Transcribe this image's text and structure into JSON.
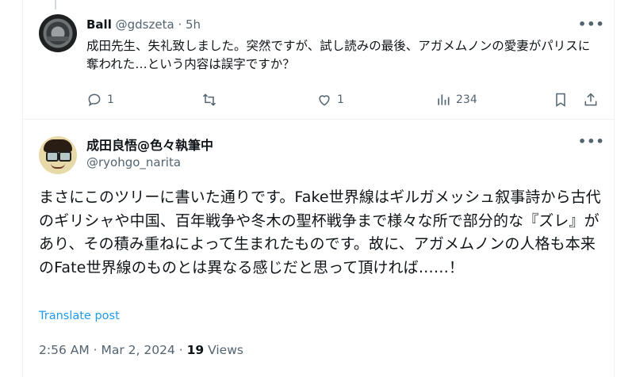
{
  "reply_tweet": {
    "display_name": "Ball",
    "handle": "@gdszeta",
    "separator": "·",
    "time": "5h",
    "more_label": "•••",
    "text": "成田先生、失礼致しました。突然ですが、試し読みの最後、アガメムノンの愛妻がパリスに奪われた…という内容は誤字ですか？",
    "replies": "1",
    "retweets": "",
    "likes": "1",
    "views": "234"
  },
  "main_tweet": {
    "display_name": "成田良悟@色々執筆中",
    "handle": "@ryohgo_narita",
    "more_label": "•••",
    "text": "まさにこのツリーに書いた通りです。Fake世界線はギルガメッシュ叙事詩から古代のギリシャや中国、百年戦争や冬木の聖杯戦争まで様々な所で部分的な『ズレ』があり、その積み重ねによって生まれたものです。故に、アガメムノンの人格も本来のFate世界線のものとは異なる感じだと思って頂ければ……！",
    "translate_label": "Translate post",
    "timestamp": "2:56 AM · Mar 2, 2024 · ",
    "views_count": "19",
    "views_label": " Views"
  },
  "colors": {
    "text": "#0f1419",
    "muted": "#536471",
    "link": "#1d9bf0",
    "border": "#eff3f4"
  },
  "icons": [
    "reply-icon",
    "retweet-icon",
    "like-icon",
    "views-icon",
    "bookmark-icon",
    "share-icon",
    "more-icon"
  ]
}
